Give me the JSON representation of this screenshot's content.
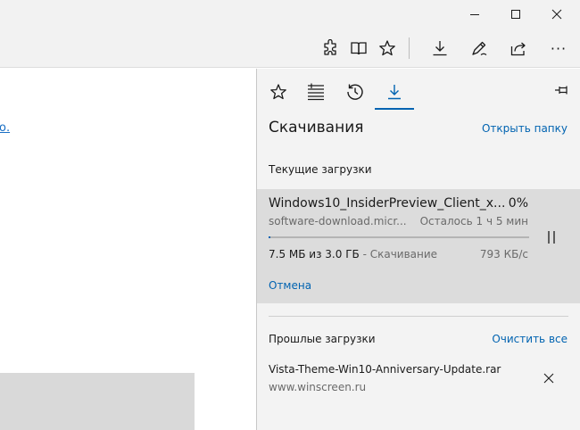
{
  "toolbar": {
    "icons": [
      "extensions-icon",
      "reading-view-icon",
      "favorite-star-icon",
      "downloads-icon",
      "pen-icon",
      "share-icon",
      "more-icon"
    ],
    "more_label": "···"
  },
  "page": {
    "link_text": "ю."
  },
  "hub": {
    "title": "Скачивания",
    "open_folder": "Открыть папку",
    "current_section": "Текущие загрузки",
    "current_download": {
      "name": "Windows10_InsiderPreview_Client_x...",
      "percent": "0%",
      "progress_fraction": 0.005,
      "source": "software-download.micr...",
      "remaining": "Осталось  1 ч 5 мин",
      "size": "7.5 МБ из 3.0 ГБ",
      "state": " - Скачивание",
      "speed": "793 КБ/с",
      "cancel": "Отмена"
    },
    "past_section": "Прошлые загрузки",
    "clear_all": "Очистить все",
    "past_download": {
      "name": "Vista-Theme-Win10-Anniversary-Update.rar",
      "source": "www.winscreen.ru"
    }
  },
  "colors": {
    "accent": "#0063b1",
    "link": "#1a6fc4",
    "chrome_bg": "#f2f2f2",
    "panel_bg": "#f3f3f3",
    "active_item_bg": "#dcdcdc"
  }
}
